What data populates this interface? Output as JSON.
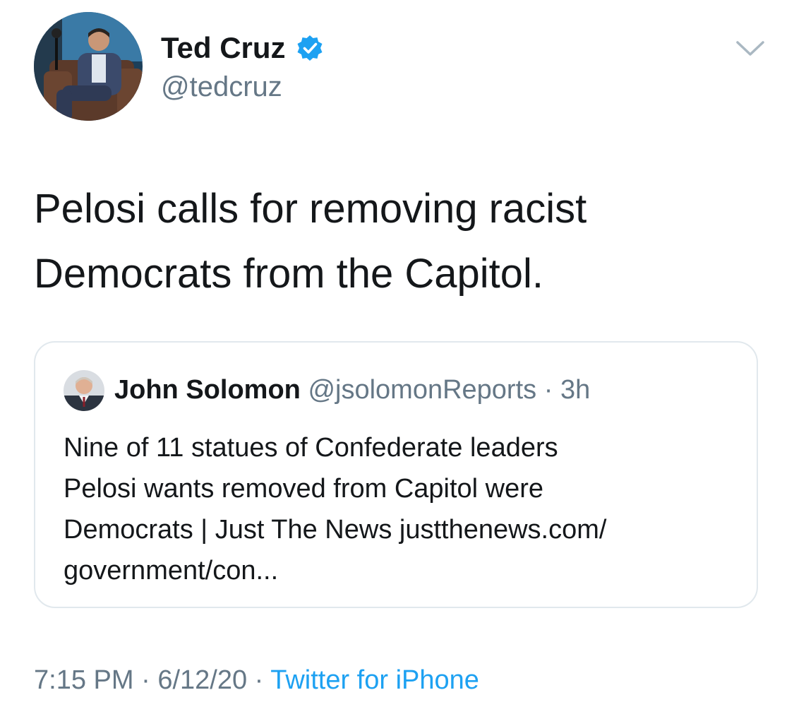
{
  "author": {
    "name": "Ted Cruz",
    "handle": "@tedcruz",
    "verified": true,
    "avatar_icon": "profile-photo-man-in-chair",
    "verified_icon": "verified-badge-icon"
  },
  "tweet": {
    "line1": "Pelosi calls for removing racist",
    "line2": "Democrats from the Capitol."
  },
  "quoted": {
    "name": "John Solomon",
    "handle": "@jsolomonReports",
    "separator": "·",
    "time": "3h",
    "lines": [
      "Nine of 11 statues of Confederate leaders",
      "Pelosi wants removed from Capitol were",
      "Democrats | Just The News justthenews.com/",
      "government/con..."
    ]
  },
  "footer": {
    "time": "7:15 PM",
    "sep1": "·",
    "date": "6/12/20",
    "sep2": "·",
    "source": "Twitter for iPhone"
  },
  "colors": {
    "link": "#1da1f2",
    "secondary": "#657786",
    "text": "#14171a",
    "border": "#e1e8ed"
  }
}
